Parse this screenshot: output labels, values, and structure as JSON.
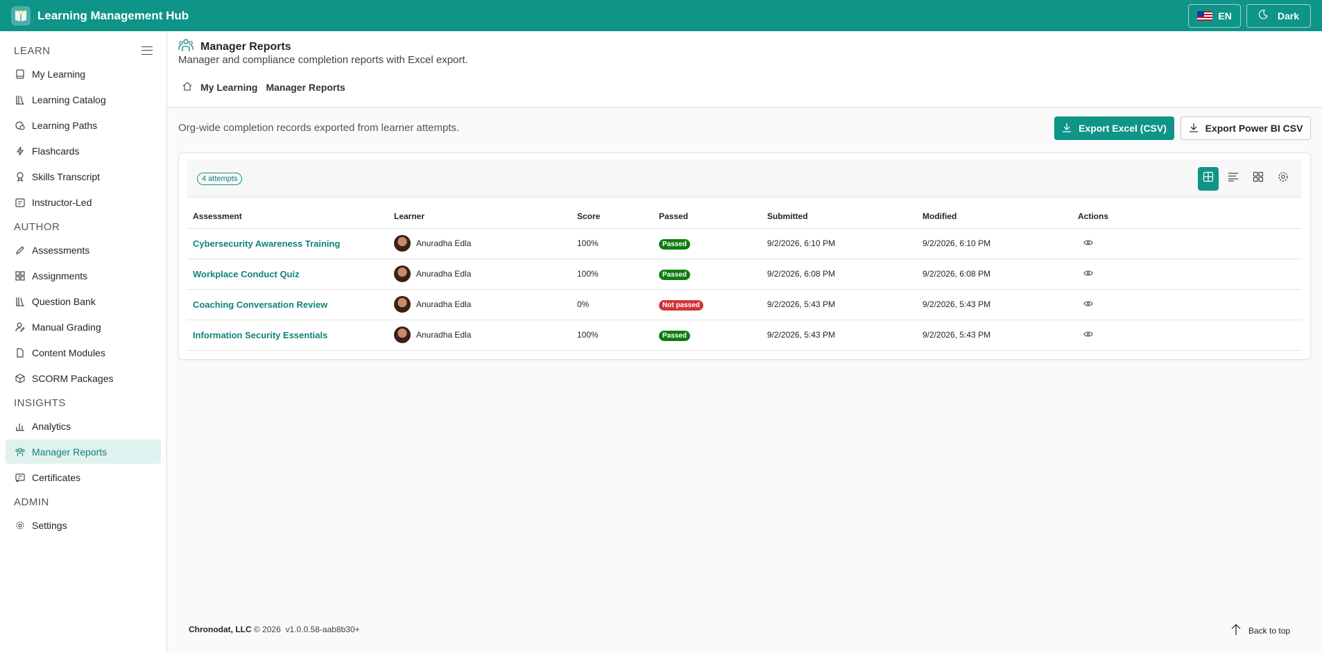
{
  "app": {
    "title": "Learning Management Hub"
  },
  "topbar": {
    "language": "EN",
    "theme_label": "Dark"
  },
  "sidebar": {
    "sections": [
      {
        "title": "LEARN",
        "items": [
          {
            "label": "My Learning",
            "icon": "book-icon"
          },
          {
            "label": "Learning Catalog",
            "icon": "library-icon"
          },
          {
            "label": "Learning Paths",
            "icon": "path-icon"
          },
          {
            "label": "Flashcards",
            "icon": "flash-icon"
          },
          {
            "label": "Skills Transcript",
            "icon": "ribbon-icon"
          },
          {
            "label": "Instructor-Led",
            "icon": "calendar-icon"
          }
        ]
      },
      {
        "title": "AUTHOR",
        "items": [
          {
            "label": "Assessments",
            "icon": "pencil-icon"
          },
          {
            "label": "Assignments",
            "icon": "grid-icon"
          },
          {
            "label": "Question Bank",
            "icon": "library-icon"
          },
          {
            "label": "Manual Grading",
            "icon": "person-edit-icon"
          },
          {
            "label": "Content Modules",
            "icon": "document-icon"
          },
          {
            "label": "SCORM Packages",
            "icon": "cube-icon"
          }
        ]
      },
      {
        "title": "INSIGHTS",
        "items": [
          {
            "label": "Analytics",
            "icon": "chart-icon"
          },
          {
            "label": "Manager Reports",
            "icon": "people-icon",
            "active": true
          },
          {
            "label": "Certificates",
            "icon": "certificate-icon"
          }
        ]
      },
      {
        "title": "ADMIN",
        "items": [
          {
            "label": "Settings",
            "icon": "gear-icon"
          }
        ]
      }
    ]
  },
  "header": {
    "title": "Manager Reports",
    "subtitle": "Manager and compliance completion reports with Excel export.",
    "breadcrumb": [
      "My Learning",
      "Manager Reports"
    ]
  },
  "content": {
    "description": "Org-wide completion records exported from learner attempts.",
    "export_excel": "Export Excel (CSV)",
    "export_powerbi": "Export Power BI CSV",
    "attempts_badge": "4 attempts",
    "columns": [
      "Assessment",
      "Learner",
      "Score",
      "Passed",
      "Submitted",
      "Modified",
      "Actions"
    ],
    "rows": [
      {
        "assessment": "Cybersecurity Awareness Training",
        "learner": "Anuradha Edla",
        "score": "100%",
        "passed": "Passed",
        "status": "pass",
        "submitted": "9/2/2026, 6:10 PM",
        "modified": "9/2/2026, 6:10 PM"
      },
      {
        "assessment": "Workplace Conduct Quiz",
        "learner": "Anuradha Edla",
        "score": "100%",
        "passed": "Passed",
        "status": "pass",
        "submitted": "9/2/2026, 6:08 PM",
        "modified": "9/2/2026, 6:08 PM"
      },
      {
        "assessment": "Coaching Conversation Review",
        "learner": "Anuradha Edla",
        "score": "0%",
        "passed": "Not passed",
        "status": "fail",
        "submitted": "9/2/2026, 5:43 PM",
        "modified": "9/2/2026, 5:43 PM"
      },
      {
        "assessment": "Information Security Essentials",
        "learner": "Anuradha Edla",
        "score": "100%",
        "passed": "Passed",
        "status": "pass",
        "submitted": "9/2/2026, 5:43 PM",
        "modified": "9/2/2026, 5:43 PM"
      }
    ]
  },
  "footer": {
    "company": "Chronodat, LLC",
    "copyright": "© 2026",
    "version": "v1.0.0.58-aab8b30+",
    "back_to_top": "Back to top"
  },
  "colors": {
    "accent": "#0f9488",
    "passed": "#107c10",
    "not_passed": "#d13438"
  }
}
